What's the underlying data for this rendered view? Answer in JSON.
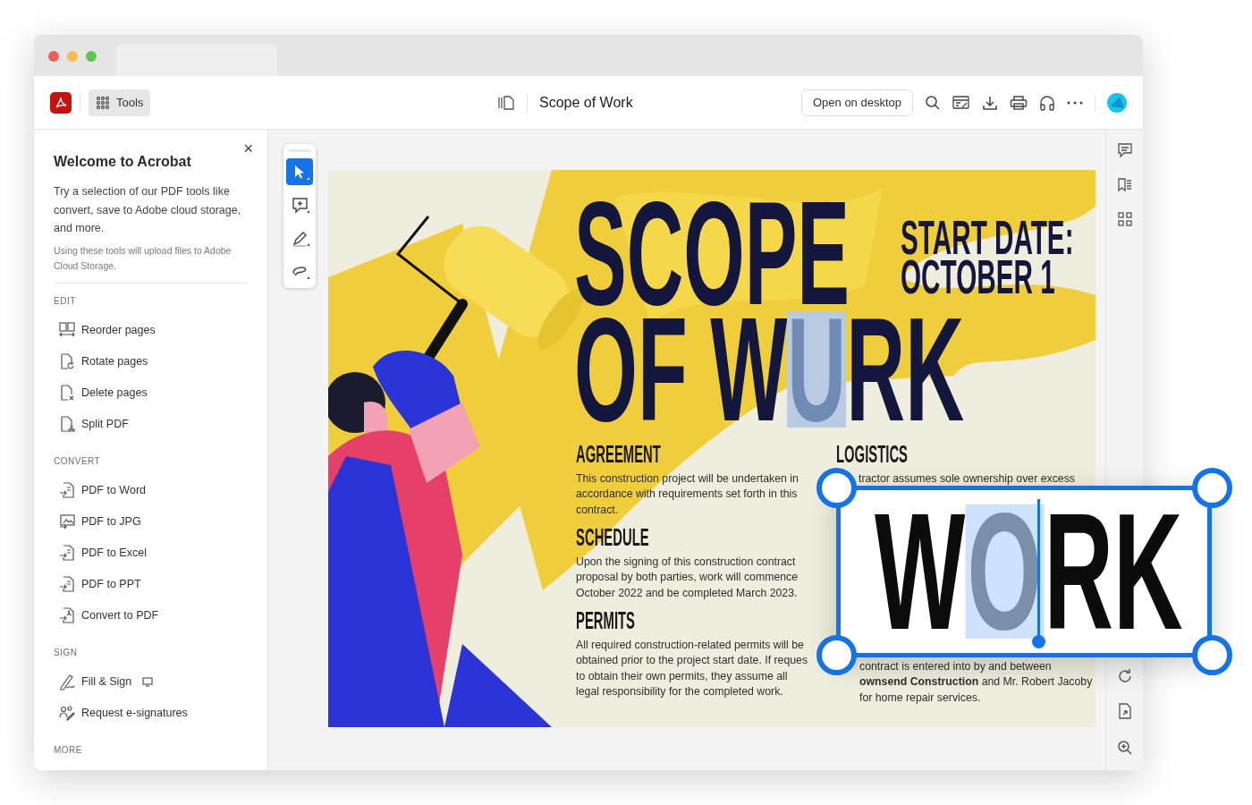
{
  "header": {
    "tools_label": "Tools",
    "document_title": "Scope of Work",
    "open_button": "Open on desktop"
  },
  "sidebar": {
    "title": "Welcome to Acrobat",
    "close": "×",
    "intro": "Try a selection of our PDF tools like convert, save to Adobe cloud storage, and more.",
    "note": "Using these tools will upload files to Adobe Cloud Storage.",
    "sections": [
      {
        "heading": "EDIT",
        "items": [
          {
            "label": "Reorder pages",
            "desktop_badge": false
          },
          {
            "label": "Rotate pages",
            "desktop_badge": false
          },
          {
            "label": "Delete pages",
            "desktop_badge": false
          },
          {
            "label": "Split PDF",
            "desktop_badge": false
          }
        ]
      },
      {
        "heading": "CONVERT",
        "items": [
          {
            "label": "PDF to Word",
            "desktop_badge": false
          },
          {
            "label": "PDF to JPG",
            "desktop_badge": false
          },
          {
            "label": "PDF to Excel",
            "desktop_badge": false
          },
          {
            "label": "PDF to PPT",
            "desktop_badge": false
          },
          {
            "label": "Convert to PDF",
            "desktop_badge": false
          }
        ]
      },
      {
        "heading": "SIGN",
        "items": [
          {
            "label": "Fill & Sign",
            "desktop_badge": true
          },
          {
            "label": "Request e-signatures",
            "desktop_badge": false
          }
        ]
      },
      {
        "heading": "MORE"
      }
    ]
  },
  "toolbar": [
    {
      "selected": true
    },
    {
      "selected": false
    },
    {
      "selected": false
    },
    {
      "selected": false
    }
  ],
  "document": {
    "title_line_1": "SCOPE",
    "title_line_2": [
      {
        "text": "OF W",
        "selected": false
      },
      {
        "text": "U",
        "selected": true
      },
      {
        "text": "RK",
        "selected": false
      }
    ],
    "start_date": [
      "START DATE:",
      "OCTOBER 1"
    ],
    "sections": [
      {
        "heading": "AGREEMENT",
        "text": "This construction project will be undertaken in accordance with requirements set forth in this contract."
      },
      {
        "heading": "SCHEDULE",
        "text": "Upon the signing of this construction contract proposal by both parties, work will commence October 2022 and be completed March 2023."
      },
      {
        "heading": "PERMITS",
        "text": "All required construction-related permits will be obtained prior to the project start date. If reques to obtain their own permits, they assume all legal responsibility for the completed work."
      }
    ],
    "logistics": {
      "heading": "LOGISTICS",
      "text_top": "tractor assumes sole ownership over excess",
      "text_bottom": "contract is entered into by and between **ownsend Construction** and Mr. Robert Jacoby for home repair services."
    }
  },
  "callout": [
    {
      "text": "W",
      "selected": false
    },
    {
      "text": "O",
      "selected": true
    },
    {
      "text": "RK",
      "selected": false
    }
  ]
}
